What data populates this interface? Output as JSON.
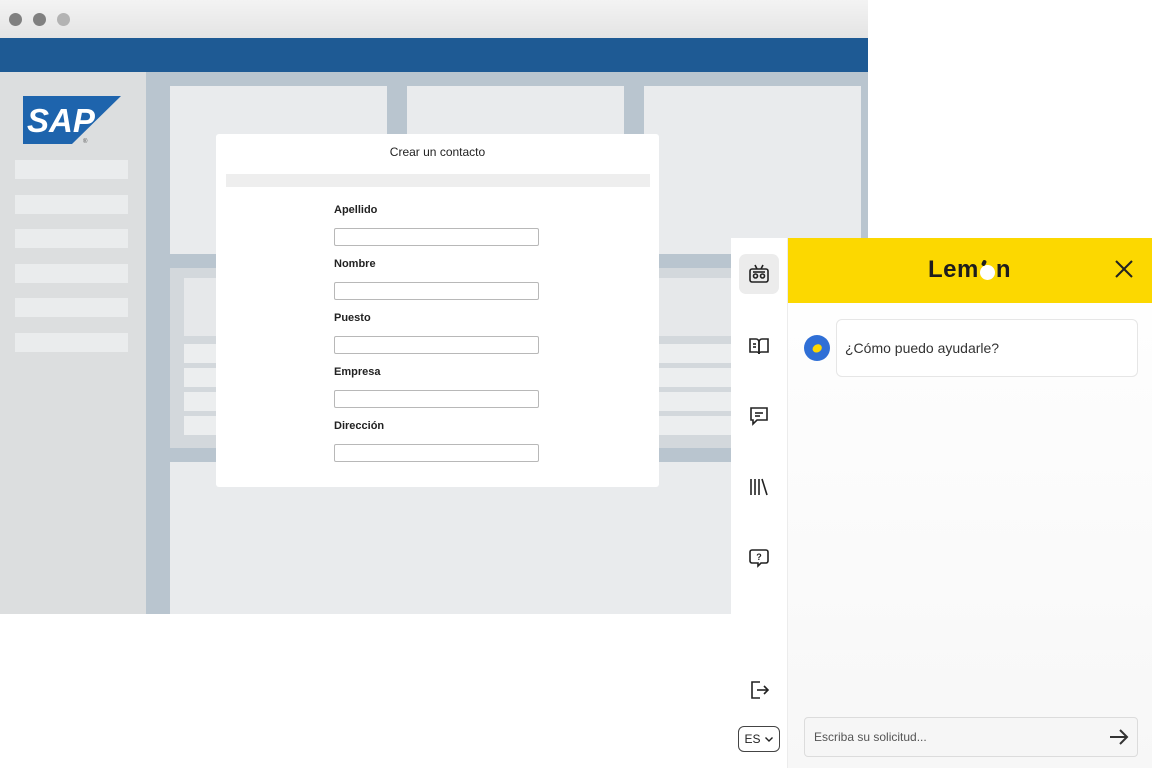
{
  "app": {
    "logo_text": "SAP"
  },
  "dialog": {
    "title": "Crear un contacto",
    "fields": [
      {
        "label": "Apellido",
        "value": ""
      },
      {
        "label": "Nombre",
        "value": ""
      },
      {
        "label": "Puesto",
        "value": ""
      },
      {
        "label": "Empresa",
        "value": ""
      },
      {
        "label": "Dirección",
        "value": ""
      }
    ]
  },
  "assistant": {
    "brand_left": "Lem",
    "brand_right": "n",
    "greeting": "¿Cómo puedo ayudarle?",
    "input_placeholder": "Escriba su solicitud...",
    "language": "ES",
    "rail_icons": [
      "robot-icon",
      "book-icon",
      "chat-icon",
      "library-icon",
      "help-icon",
      "logout-icon"
    ],
    "colors": {
      "header": "#fcd800",
      "avatar": "#2f6fd6",
      "shellbar": "#1e5a94"
    }
  }
}
